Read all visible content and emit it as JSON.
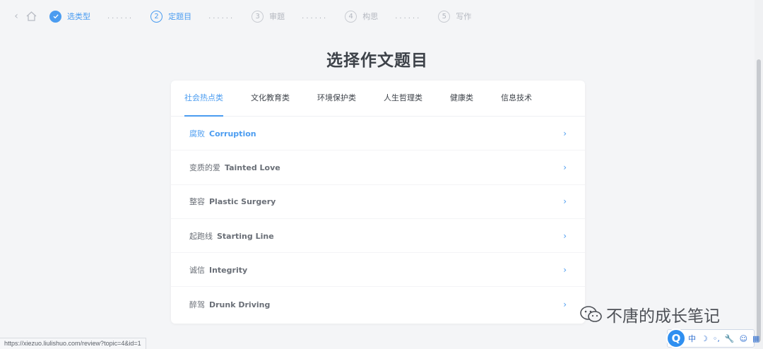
{
  "stepper": {
    "steps": [
      {
        "num": "",
        "label": "选类型"
      },
      {
        "num": "2",
        "label": "定题目"
      },
      {
        "num": "3",
        "label": "审题"
      },
      {
        "num": "4",
        "label": "构思"
      },
      {
        "num": "5",
        "label": "写作"
      }
    ],
    "separator": "......"
  },
  "page_title": "选择作文题目",
  "tabs": [
    {
      "label": "社会热点类"
    },
    {
      "label": "文化教育类"
    },
    {
      "label": "环境保护类"
    },
    {
      "label": "人生哲理类"
    },
    {
      "label": "健康类"
    },
    {
      "label": "信息技术"
    }
  ],
  "topics": [
    {
      "cn": "腐败",
      "en": "Corruption"
    },
    {
      "cn": "变质的爱",
      "en": "Tainted Love"
    },
    {
      "cn": "整容",
      "en": "Plastic Surgery"
    },
    {
      "cn": "起跑线",
      "en": "Starting Line"
    },
    {
      "cn": "诚信",
      "en": "Integrity"
    },
    {
      "cn": "醉驾",
      "en": "Drunk Driving"
    }
  ],
  "status_url": "https://xiezuo.liulishuo.com/review?topic=4&id=1",
  "watermark": "不唐的成长笔记",
  "ime": {
    "logo": "Q",
    "items": [
      "中",
      "☽",
      "◦,",
      "🔧",
      "☺",
      "▦"
    ]
  },
  "colors": {
    "accent": "#4b9cf0",
    "background": "#f4f5f7"
  },
  "icons": {
    "back": "chevron-left-icon",
    "home": "home-icon",
    "item_arrow": "chevron-right-icon",
    "done": "check-icon"
  }
}
